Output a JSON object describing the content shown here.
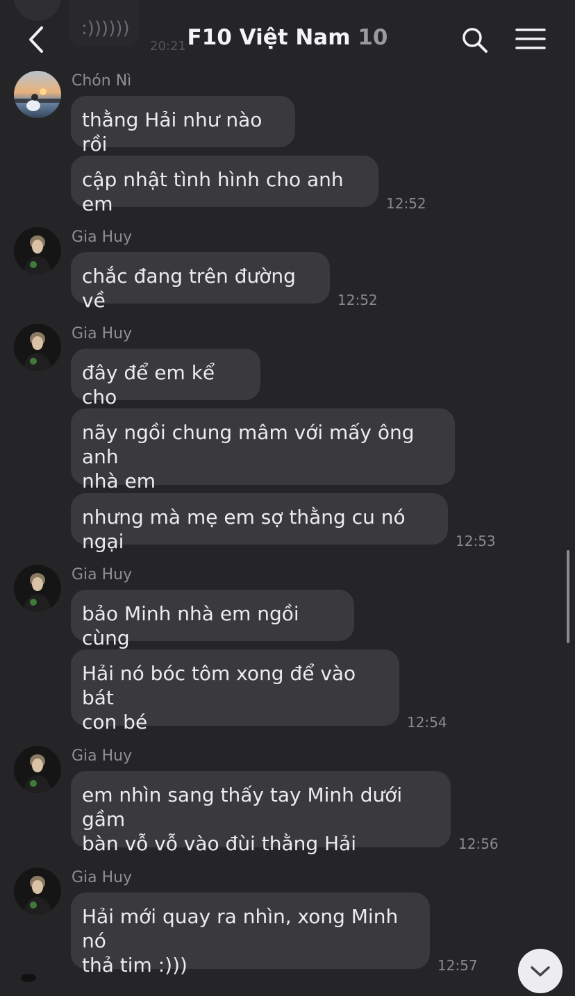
{
  "header": {
    "title": "F10 Việt Nam",
    "member_count": "10",
    "back_icon": "chevron-left-icon",
    "search_icon": "search-icon",
    "menu_icon": "hamburger-menu-icon"
  },
  "previous_message": {
    "text": ":))))))",
    "time": "20:21"
  },
  "groups": [
    {
      "sender": "Chón Nì",
      "messages": [
        "thằng Hải như nào rồi",
        "cập nhật tình hình cho anh em"
      ],
      "time": "12:52"
    },
    {
      "sender": "Gia Huy",
      "messages": [
        "chắc đang trên đường về"
      ],
      "time": "12:52"
    },
    {
      "sender": "Gia Huy",
      "messages": [
        "đây để em kể cho",
        "nãy ngồi chung mâm với mấy ông anh\nnhà em",
        "nhưng mà mẹ em sợ thằng cu nó ngại"
      ],
      "time": "12:53"
    },
    {
      "sender": "Gia Huy",
      "messages": [
        "bảo Minh nhà em ngồi cùng",
        "Hải nó bóc tôm xong để vào bát\ncon bé"
      ],
      "time": "12:54"
    },
    {
      "sender": "Gia Huy",
      "messages": [
        "em nhìn sang thấy tay Minh dưới gầm\nbàn vỗ vỗ vào đùi thằng Hải"
      ],
      "time": "12:56"
    },
    {
      "sender": "Gia Huy",
      "messages": [
        "Hải mới quay ra nhìn, xong Minh nó\nthả tim :)))"
      ],
      "time": "12:57"
    }
  ],
  "colors": {
    "background": "#252528",
    "bubble": "#3a3a3e",
    "text": "#ececef",
    "muted": "#8e8e94"
  },
  "scroll_to_bottom_icon": "chevron-down-icon"
}
